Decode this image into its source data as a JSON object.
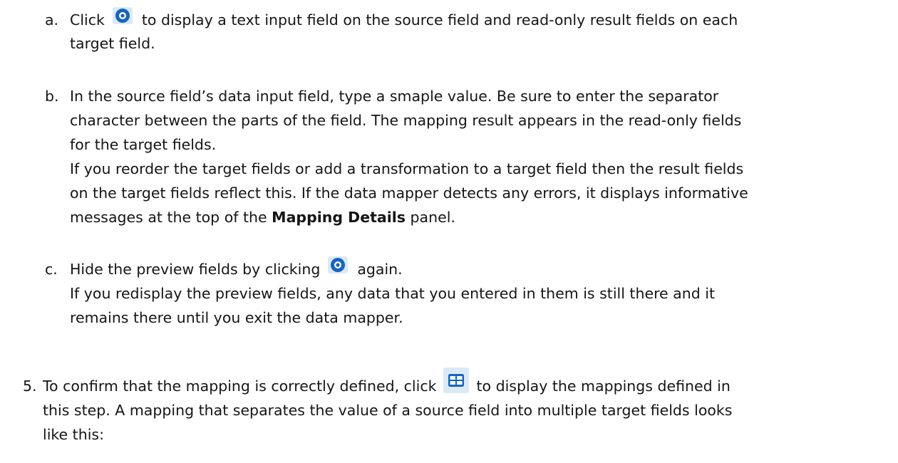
{
  "steps": {
    "a": {
      "marker": "a.",
      "line1_before": "Click",
      "line1_after": "to display a text input field on the source field and read-only result fields on each",
      "line2": "target field."
    },
    "b": {
      "marker": "b.",
      "line1": "In the source field’s data input field, type a smaple value. Be sure to enter the separator",
      "line2": "character between the parts of the field. The mapping result appears in the read-only fields",
      "line3": "for the target fields.",
      "line4": "If you reorder the target fields or add a transformation to a target field then the result fields",
      "line5": "on the target fields reflect this. If the data mapper detects any errors, it displays informative",
      "line6_before": "messages at the top of the",
      "line6_bold": "Mapping Details",
      "line6_after": "panel."
    },
    "c": {
      "marker": "c.",
      "line1_before": "Hide the preview fields by clicking",
      "line1_after": "again.",
      "line2": "If you redisplay the preview fields, any data that you entered in them is still there and it",
      "line3": "remains there until you exit the data mapper."
    },
    "step5": {
      "marker": "5.",
      "line1_before": "To confirm that the mapping is correctly defined, click",
      "line1_after": "to display the mappings defined in",
      "line2": "this step. A mapping that separates the value of a source field into multiple target fields looks",
      "line3": "like this:"
    }
  },
  "icons": {
    "preview": "eye-icon",
    "mappings_table": "grid-icon"
  },
  "colors": {
    "text": "#151515",
    "icon_blue": "#1565c0",
    "icon_light": "#dbe9f7"
  }
}
